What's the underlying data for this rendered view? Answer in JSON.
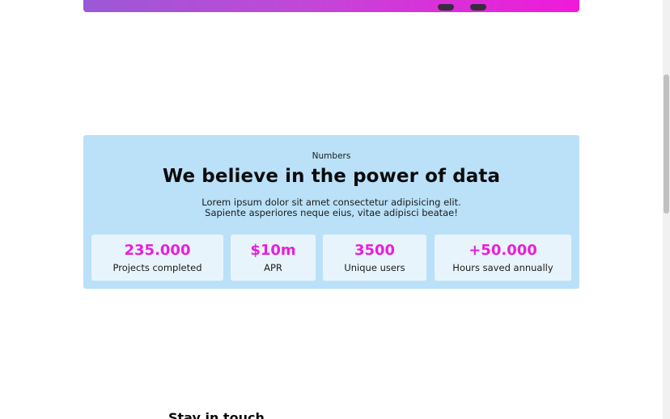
{
  "hero": {
    "gradient_start": "#9b59d6",
    "gradient_end": "#f01ad8"
  },
  "numbers": {
    "eyebrow": "Numbers",
    "headline": "We believe in the power of data",
    "intro_line1": "Lorem ipsum dolor sit amet consectetur adipisicing elit.",
    "intro_line2": "Sapiente asperiores neque eius, vitae adipisci beatae!",
    "background_color": "#bae1f8",
    "accent_color": "#e91edb",
    "stats": [
      {
        "value": "235.000",
        "label": "Projects completed"
      },
      {
        "value": "$10m",
        "label": "APR"
      },
      {
        "value": "3500",
        "label": "Unique users"
      },
      {
        "value": "+50.000",
        "label": "Hours saved annually"
      }
    ]
  },
  "contact": {
    "heading": "Stay in touch"
  }
}
